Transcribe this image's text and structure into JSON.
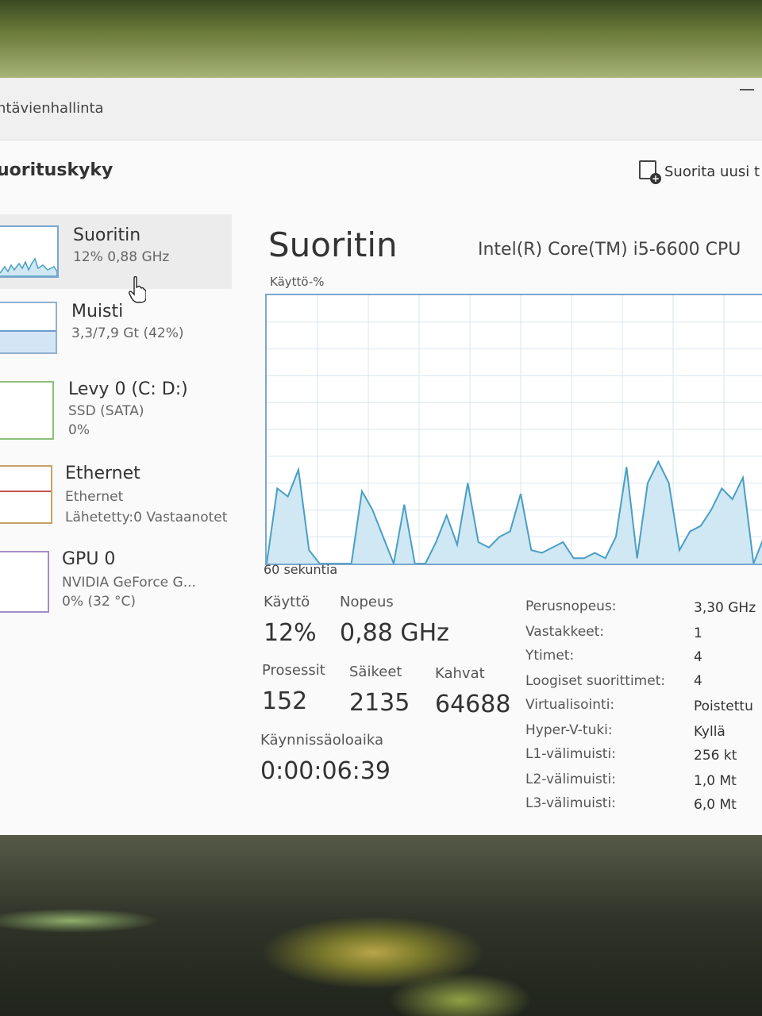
{
  "app": {
    "title": "ntävienhallinta",
    "header": "uorituskyky",
    "run_task": "Suorita uusi t"
  },
  "sidebar": {
    "items": [
      {
        "name": "Suoritin",
        "sub": "12% 0,88 GHz"
      },
      {
        "name": "Muisti",
        "sub": "3,3/7,9 Gt (42%)"
      },
      {
        "name": "Levy 0 (C: D:)",
        "sub": "SSD (SATA)",
        "sub2": "0%"
      },
      {
        "name": "Ethernet",
        "sub": "Ethernet",
        "sub2": "Lähetetty:0 Vastaanotet"
      },
      {
        "name": "GPU 0",
        "sub": "NVIDIA GeForce G...",
        "sub2": "0% (32 °C)"
      }
    ]
  },
  "main": {
    "title": "Suoritin",
    "cpu_name": "Intel(R) Core(TM) i5-6600 CPU",
    "graph_label": "Käyttö-%",
    "time_label": "60 sekuntia",
    "stats": {
      "usage_label": "Käyttö",
      "usage_value": "12%",
      "speed_label": "Nopeus",
      "speed_value": "0,88 GHz",
      "processes_label": "Prosessit",
      "processes_value": "152",
      "threads_label": "Säikeet",
      "threads_value": "2135",
      "handles_label": "Kahvat",
      "handles_value": "64688",
      "uptime_label": "Käynnissäoloaika",
      "uptime_value": "0:00:06:39"
    },
    "specs": [
      {
        "label": "Perusnopeus:",
        "value": "3,30 GHz"
      },
      {
        "label": "Vastakkeet:",
        "value": "1"
      },
      {
        "label": "Ytimet:",
        "value": "4"
      },
      {
        "label": "Loogiset suorittimet:",
        "value": "4"
      },
      {
        "label": "Virtualisointi:",
        "value": "Poistettu"
      },
      {
        "label": "Hyper-V-tuki:",
        "value": "Kyllä"
      },
      {
        "label": "L1-välimuisti:",
        "value": "256 kt"
      },
      {
        "label": "L2-välimuisti:",
        "value": "1,0 Mt"
      },
      {
        "label": "L3-välimuisti:",
        "value": "6,0 Mt"
      }
    ]
  },
  "colors": {
    "graph_line": "#4a9ec4",
    "graph_fill": "#cfe8f3",
    "grid": "#d9e6f0",
    "border": "#7aa7cf"
  },
  "chart_data": {
    "type": "area",
    "ylim": [
      0,
      100
    ],
    "values": [
      0,
      28,
      25,
      35,
      5,
      0,
      0,
      0,
      0,
      27,
      20,
      10,
      0,
      22,
      0,
      0,
      8,
      18,
      7,
      30,
      8,
      6,
      10,
      12,
      26,
      5,
      4,
      6,
      8,
      2,
      2,
      4,
      2,
      10,
      36,
      2,
      30,
      38,
      30,
      5,
      12,
      14,
      20,
      28,
      24,
      32,
      0,
      10,
      8
    ]
  }
}
